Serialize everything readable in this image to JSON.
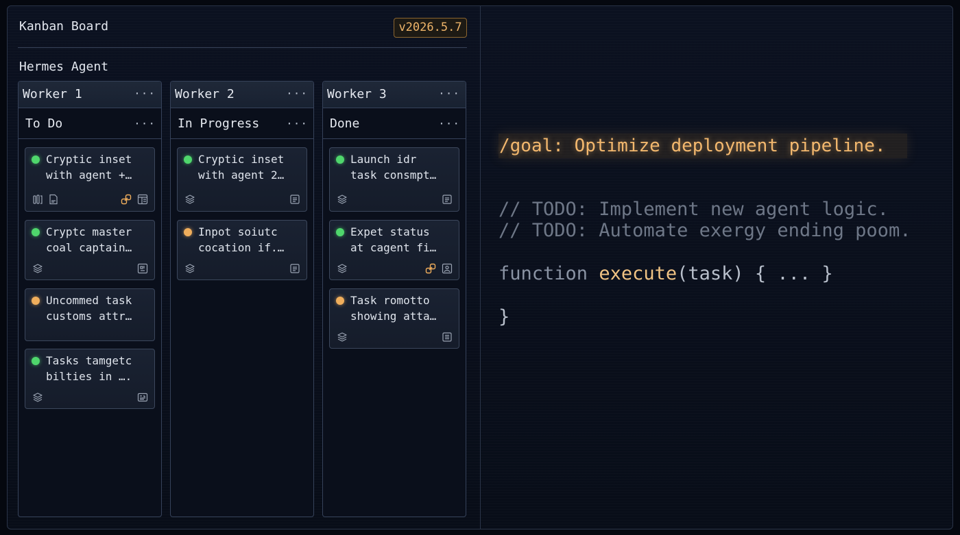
{
  "board": {
    "title": "Kanban Board",
    "version": "v2026.5.7",
    "agent": "Hermes Agent",
    "menu_glyph": "···"
  },
  "columns": [
    {
      "worker": "Worker 1",
      "status": "To Do",
      "cards": [
        {
          "line1": "Cryptic inset",
          "line2": "with agent +…",
          "dot": "green",
          "icons": [
            "tools-icon",
            "document-icon",
            "link-icon",
            "board-icon"
          ]
        },
        {
          "line1": "Cryptc master",
          "line2": "coal captain…",
          "dot": "green",
          "icons": [
            "layers-icon",
            "grid-icon"
          ]
        },
        {
          "line1": "Uncommed task",
          "line2": "customs attr…",
          "dot": "orange",
          "icons": []
        },
        {
          "line1": "Tasks tamgetc",
          "line2": "bilties in ….",
          "dot": "green",
          "icons": [
            "layers-icon",
            "card-icon"
          ]
        }
      ]
    },
    {
      "worker": "Worker 2",
      "status": "In Progress",
      "cards": [
        {
          "line1": "Cryptic inset",
          "line2": "with agent 2…",
          "dot": "green",
          "icons": [
            "layers-icon",
            "document-icon"
          ]
        },
        {
          "line1": "Inpot soiutc",
          "line2": "cocation if.…",
          "dot": "orange",
          "icons": [
            "layers-icon",
            "document-icon"
          ]
        }
      ]
    },
    {
      "worker": "Worker 3",
      "status": "Done",
      "cards": [
        {
          "line1": "Launch idr",
          "line2": "task consmpt…",
          "dot": "green",
          "icons": [
            "layers-icon",
            "document-icon"
          ]
        },
        {
          "line1": "Expet status",
          "line2": "at cagent fi…",
          "dot": "green",
          "icons": [
            "layers-icon",
            "link-icon",
            "image-icon"
          ]
        },
        {
          "line1": "Task romotto",
          "line2": "showing atta…",
          "dot": "orange",
          "icons": [
            "layers-icon",
            "document-icon"
          ]
        }
      ]
    }
  ],
  "editor": {
    "goal": "/goal: Optimize deployment pipeline.",
    "todo1": "// TODO: Implement new agent logic.",
    "todo2": "// TODO: Automate exergy ending poom.",
    "fn_keyword": "function",
    "fn_name": "execute",
    "fn_rest": "(task) { ... }",
    "closing": "}"
  },
  "colors": {
    "accent_orange": "#f0ae5c",
    "status_green": "#4fd66c",
    "background": "#05080f"
  }
}
